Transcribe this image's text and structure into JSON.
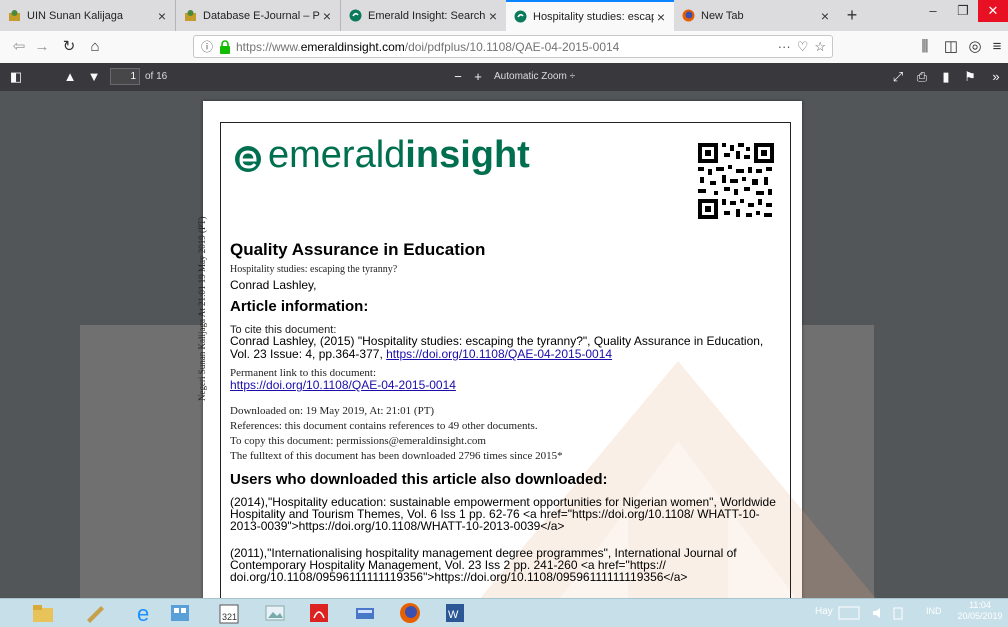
{
  "browser": {
    "tabs": [
      {
        "title": "UIN Sunan Kalijaga",
        "close": "×"
      },
      {
        "title": "Database E-Journal – PERPUST/",
        "close": "×"
      },
      {
        "title": "Emerald Insight: Search Results",
        "close": "×"
      },
      {
        "title": "Hospitality studies: escaping th",
        "close": "×",
        "active": true
      },
      {
        "title": "New Tab",
        "close": "×"
      }
    ],
    "new_tab": "+",
    "url": {
      "prefix": "https://www.",
      "domain": "emeraldinsight.com",
      "path": "/doi/pdfplus/10.1108/QAE-04-2015-0014",
      "more": "···"
    }
  },
  "pdf_toolbar": {
    "page_number": "1",
    "page_count": "of 16",
    "zoom_minus": "−",
    "zoom_plus": "+",
    "zoom_value": "Automatic Zoom  ÷"
  },
  "document": {
    "logo_light": "emerald",
    "logo_bold": "insight",
    "journal": "Quality Assurance in Education",
    "article_title": "Hospitality studies: escaping the tyranny?",
    "author": "Conrad Lashley,",
    "article_info_heading": "Article information:",
    "cite_label": "To cite this document:",
    "cite_text": "Conrad Lashley, (2015) \"Hospitality studies: escaping the tyranny?\", Quality Assurance in Education, Vol. 23 Issue: 4, pp.364-377, ",
    "cite_link": "https://doi.org/10.1108/QAE-04-2015-0014",
    "perm_label": "Permanent link to this document:",
    "perm_link": "https://doi.org/10.1108/QAE-04-2015-0014",
    "downloaded_on": "Downloaded on: 19 May 2019, At: 21:01 (PT)",
    "references": "References: this document contains references to 49 other documents.",
    "copy": "To copy this document: permissions@emeraldinsight.com",
    "fulltext": "The fulltext of this document has been downloaded 2796 times since 2015*",
    "also_heading": "Users who downloaded this article also downloaded:",
    "ref1": "(2014),\"Hospitality education: sustainable empowerment opportunities for Nigerian women\", Worldwide Hospitality and Tourism Themes, Vol. 6 Iss 1 pp. 62-76 <a href=\"https://doi.org/10.1108/ WHATT-10-2013-0039\">https://doi.org/10.1108/WHATT-10-2013-0039</a>",
    "ref2": "(2011),\"Internationalising hospitality management degree programmes\", International Journal of Contemporary Hospitality Management, Vol. 23 Iss 2 pp. 241-260 <a href=\"https:// doi.org/10.1108/09596111111119356\">https://doi.org/10.1108/09596111111119356</a>",
    "side_text": "Negeri Sunan Kalijaga At 21:01 19 May 2019 (PT)"
  },
  "taskbar": {
    "search_text": "Hay",
    "lang": "IND",
    "time": "11:04",
    "date": "20/05/2019"
  }
}
